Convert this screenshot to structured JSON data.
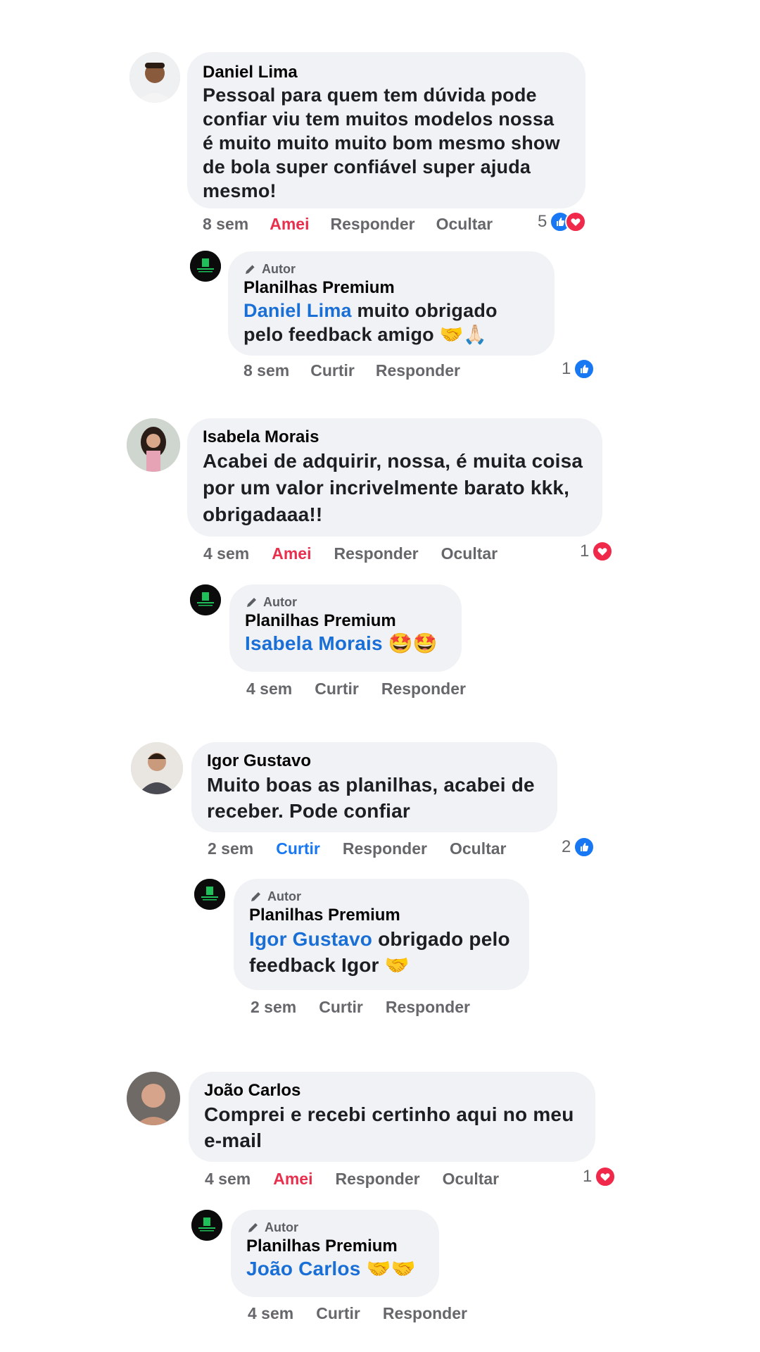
{
  "threads": [
    {
      "comment": {
        "author": "Daniel Lima",
        "text": "Pessoal para quem tem dúvida pode confiar viu tem muitos modelos nossa é muito muito muito bom mesmo show de bola super confiável  super ajuda mesmo!",
        "time": "8 sem",
        "reaction_label": "Amei",
        "reply": "Responder",
        "hide": "Ocultar",
        "reaction_count": "5",
        "reactions": [
          "like-icon",
          "love-icon"
        ]
      },
      "reply": {
        "badge": "Autor",
        "author": "Planilhas Premium",
        "mention": "Daniel Lima",
        "text": " muito obrigado pelo feedback amigo 🤝🙏🏻",
        "time": "8 sem",
        "like": "Curtir",
        "reply": "Responder",
        "reaction_count": "1",
        "reactions": [
          "like-icon"
        ]
      }
    },
    {
      "comment": {
        "author": "Isabela Morais",
        "text": "Acabei de adquirir, nossa, é muita coisa por um valor incrivelmente barato kkk, obrigadaaa!!",
        "time": "4 sem",
        "reaction_label": "Amei",
        "reply": "Responder",
        "hide": "Ocultar",
        "reaction_count": "1",
        "reactions": [
          "love-icon"
        ]
      },
      "reply": {
        "badge": "Autor",
        "author": "Planilhas Premium",
        "mention": "Isabela Morais",
        "text": " 🤩🤩",
        "time": "4 sem",
        "like": "Curtir",
        "reply": "Responder"
      }
    },
    {
      "comment": {
        "author": "Igor Gustavo",
        "text": "Muito boas as planilhas, acabei de receber. Pode confiar",
        "time": "2 sem",
        "reaction_label": "Curtir",
        "reply": "Responder",
        "hide": "Ocultar",
        "reaction_count": "2",
        "reactions": [
          "like-icon"
        ]
      },
      "reply": {
        "badge": "Autor",
        "author": "Planilhas Premium",
        "mention": "Igor Gustavo",
        "text": " obrigado pelo feedback Igor 🤝",
        "time": "2 sem",
        "like": "Curtir",
        "reply": "Responder"
      }
    },
    {
      "comment": {
        "author": "João Carlos",
        "text": "Comprei e recebi certinho aqui no meu e-mail",
        "time": "4 sem",
        "reaction_label": "Amei",
        "reply": "Responder",
        "hide": "Ocultar",
        "reaction_count": "1",
        "reactions": [
          "love-icon"
        ]
      },
      "reply": {
        "badge": "Autor",
        "author": "Planilhas Premium",
        "mention": "João Carlos",
        "text": " 🤝🤝",
        "time": "4 sem",
        "like": "Curtir",
        "reply": "Responder"
      }
    }
  ],
  "colors": {
    "bubble": "#f0f2f5",
    "mention": "#1a6fd6",
    "amei": "#e8304e",
    "curtir_active": "#1877f2",
    "action": "#65676b"
  }
}
